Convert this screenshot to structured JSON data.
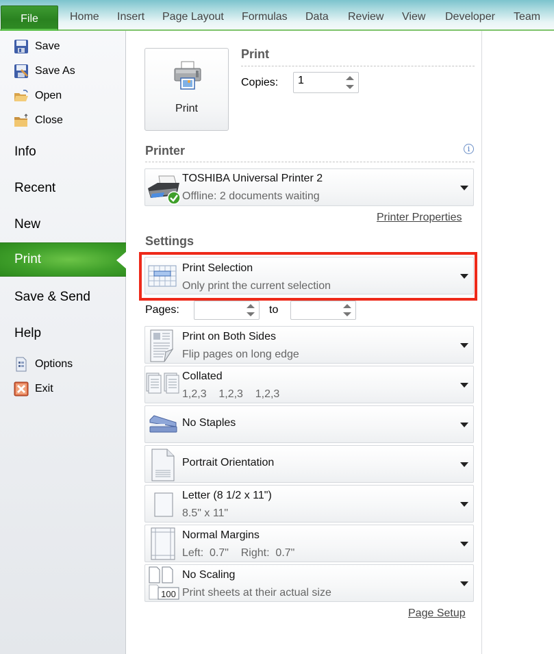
{
  "ribbon": {
    "tabs": [
      {
        "label": "File",
        "active": true
      },
      {
        "label": "Home"
      },
      {
        "label": "Insert"
      },
      {
        "label": "Page Layout"
      },
      {
        "label": "Formulas"
      },
      {
        "label": "Data"
      },
      {
        "label": "Review"
      },
      {
        "label": "View"
      },
      {
        "label": "Developer"
      },
      {
        "label": "Team"
      }
    ]
  },
  "sidebar": {
    "commands": [
      {
        "label": "Save",
        "icon": "save-icon"
      },
      {
        "label": "Save As",
        "icon": "save-as-icon"
      },
      {
        "label": "Open",
        "icon": "open-folder-icon"
      },
      {
        "label": "Close",
        "icon": "close-folder-icon"
      }
    ],
    "sections": [
      {
        "label": "Info"
      },
      {
        "label": "Recent"
      },
      {
        "label": "New"
      },
      {
        "label": "Print",
        "active": true
      },
      {
        "label": "Save & Send"
      },
      {
        "label": "Help"
      }
    ],
    "footer": [
      {
        "label": "Options",
        "icon": "options-icon"
      },
      {
        "label": "Exit",
        "icon": "exit-icon"
      }
    ],
    "active_color": "#3f9f2a"
  },
  "print": {
    "button_label": "Print",
    "section_title": "Print",
    "copies_label": "Copies:",
    "copies_value": "1"
  },
  "printer": {
    "section_title": "Printer",
    "name": "TOSHIBA Universal Printer 2",
    "status": "Offline: 2 documents waiting",
    "properties_link": "Printer Properties"
  },
  "settings": {
    "section_title": "Settings",
    "pages_label": "Pages:",
    "to_label": "to",
    "pages_from": "",
    "pages_to": "",
    "highlight_color": "#ee2a1a",
    "options": [
      {
        "title": "Print Selection",
        "subtitle": "Only print the current selection",
        "icon": "print-selection-icon",
        "highlighted": true
      },
      {
        "title": "Print on Both Sides",
        "subtitle": "Flip pages on long edge",
        "icon": "duplex-icon"
      },
      {
        "title": "Collated",
        "subtitle": "1,2,3    1,2,3    1,2,3",
        "icon": "collated-icon"
      },
      {
        "title": "No Staples",
        "subtitle": "",
        "icon": "stapler-icon"
      },
      {
        "title": "Portrait Orientation",
        "subtitle": "",
        "icon": "portrait-page-icon"
      },
      {
        "title": "Letter (8 1/2 x 11\")",
        "subtitle": "8.5\" x 11\"",
        "icon": "paper-size-icon"
      },
      {
        "title": "Normal Margins",
        "subtitle": "Left:  0.7\"    Right:  0.7\"",
        "icon": "margins-icon"
      },
      {
        "title": "No Scaling",
        "subtitle": "Print sheets at their actual size",
        "icon": "scaling-icon"
      }
    ],
    "page_setup_link": "Page Setup"
  }
}
